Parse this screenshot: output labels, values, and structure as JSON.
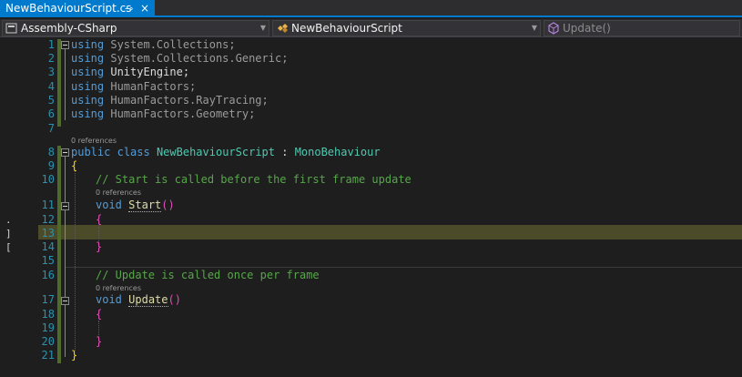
{
  "tab": {
    "title": "NewBehaviourScript.cs",
    "pin_glyph": "⊸",
    "close_glyph": "×"
  },
  "nav": {
    "project": "Assembly-CSharp",
    "type": "NewBehaviourScript",
    "member": "Update()",
    "dropdown_glyph": "▼"
  },
  "editor": {
    "line_numbers": [
      "1",
      "2",
      "3",
      "4",
      "5",
      "6",
      "7",
      "8",
      "9",
      "10",
      "11",
      "12",
      "13",
      "14",
      "15",
      "16",
      "17",
      "18",
      "19",
      "20",
      "21"
    ],
    "margin_marks": [
      ".",
      "]",
      "["
    ],
    "using_kw": "using",
    "usings": [
      "System.Collections;",
      "System.Collections.Generic;",
      "UnityEngine;",
      "HumanFactors;",
      "HumanFactors.RayTracing;",
      "HumanFactors.Geometry;"
    ],
    "codelens": "0 references",
    "class_decl": {
      "public": "public",
      "class": "class",
      "name": "NewBehaviourScript",
      "colon": " : ",
      "base": "MonoBehaviour"
    },
    "open_brace": "{",
    "close_brace": "}",
    "comment_start": "// Start is called before the first frame update",
    "comment_update": "// Update is called once per frame",
    "void": "void",
    "start_name": "Start",
    "update_name": "Update",
    "parens": "()"
  }
}
